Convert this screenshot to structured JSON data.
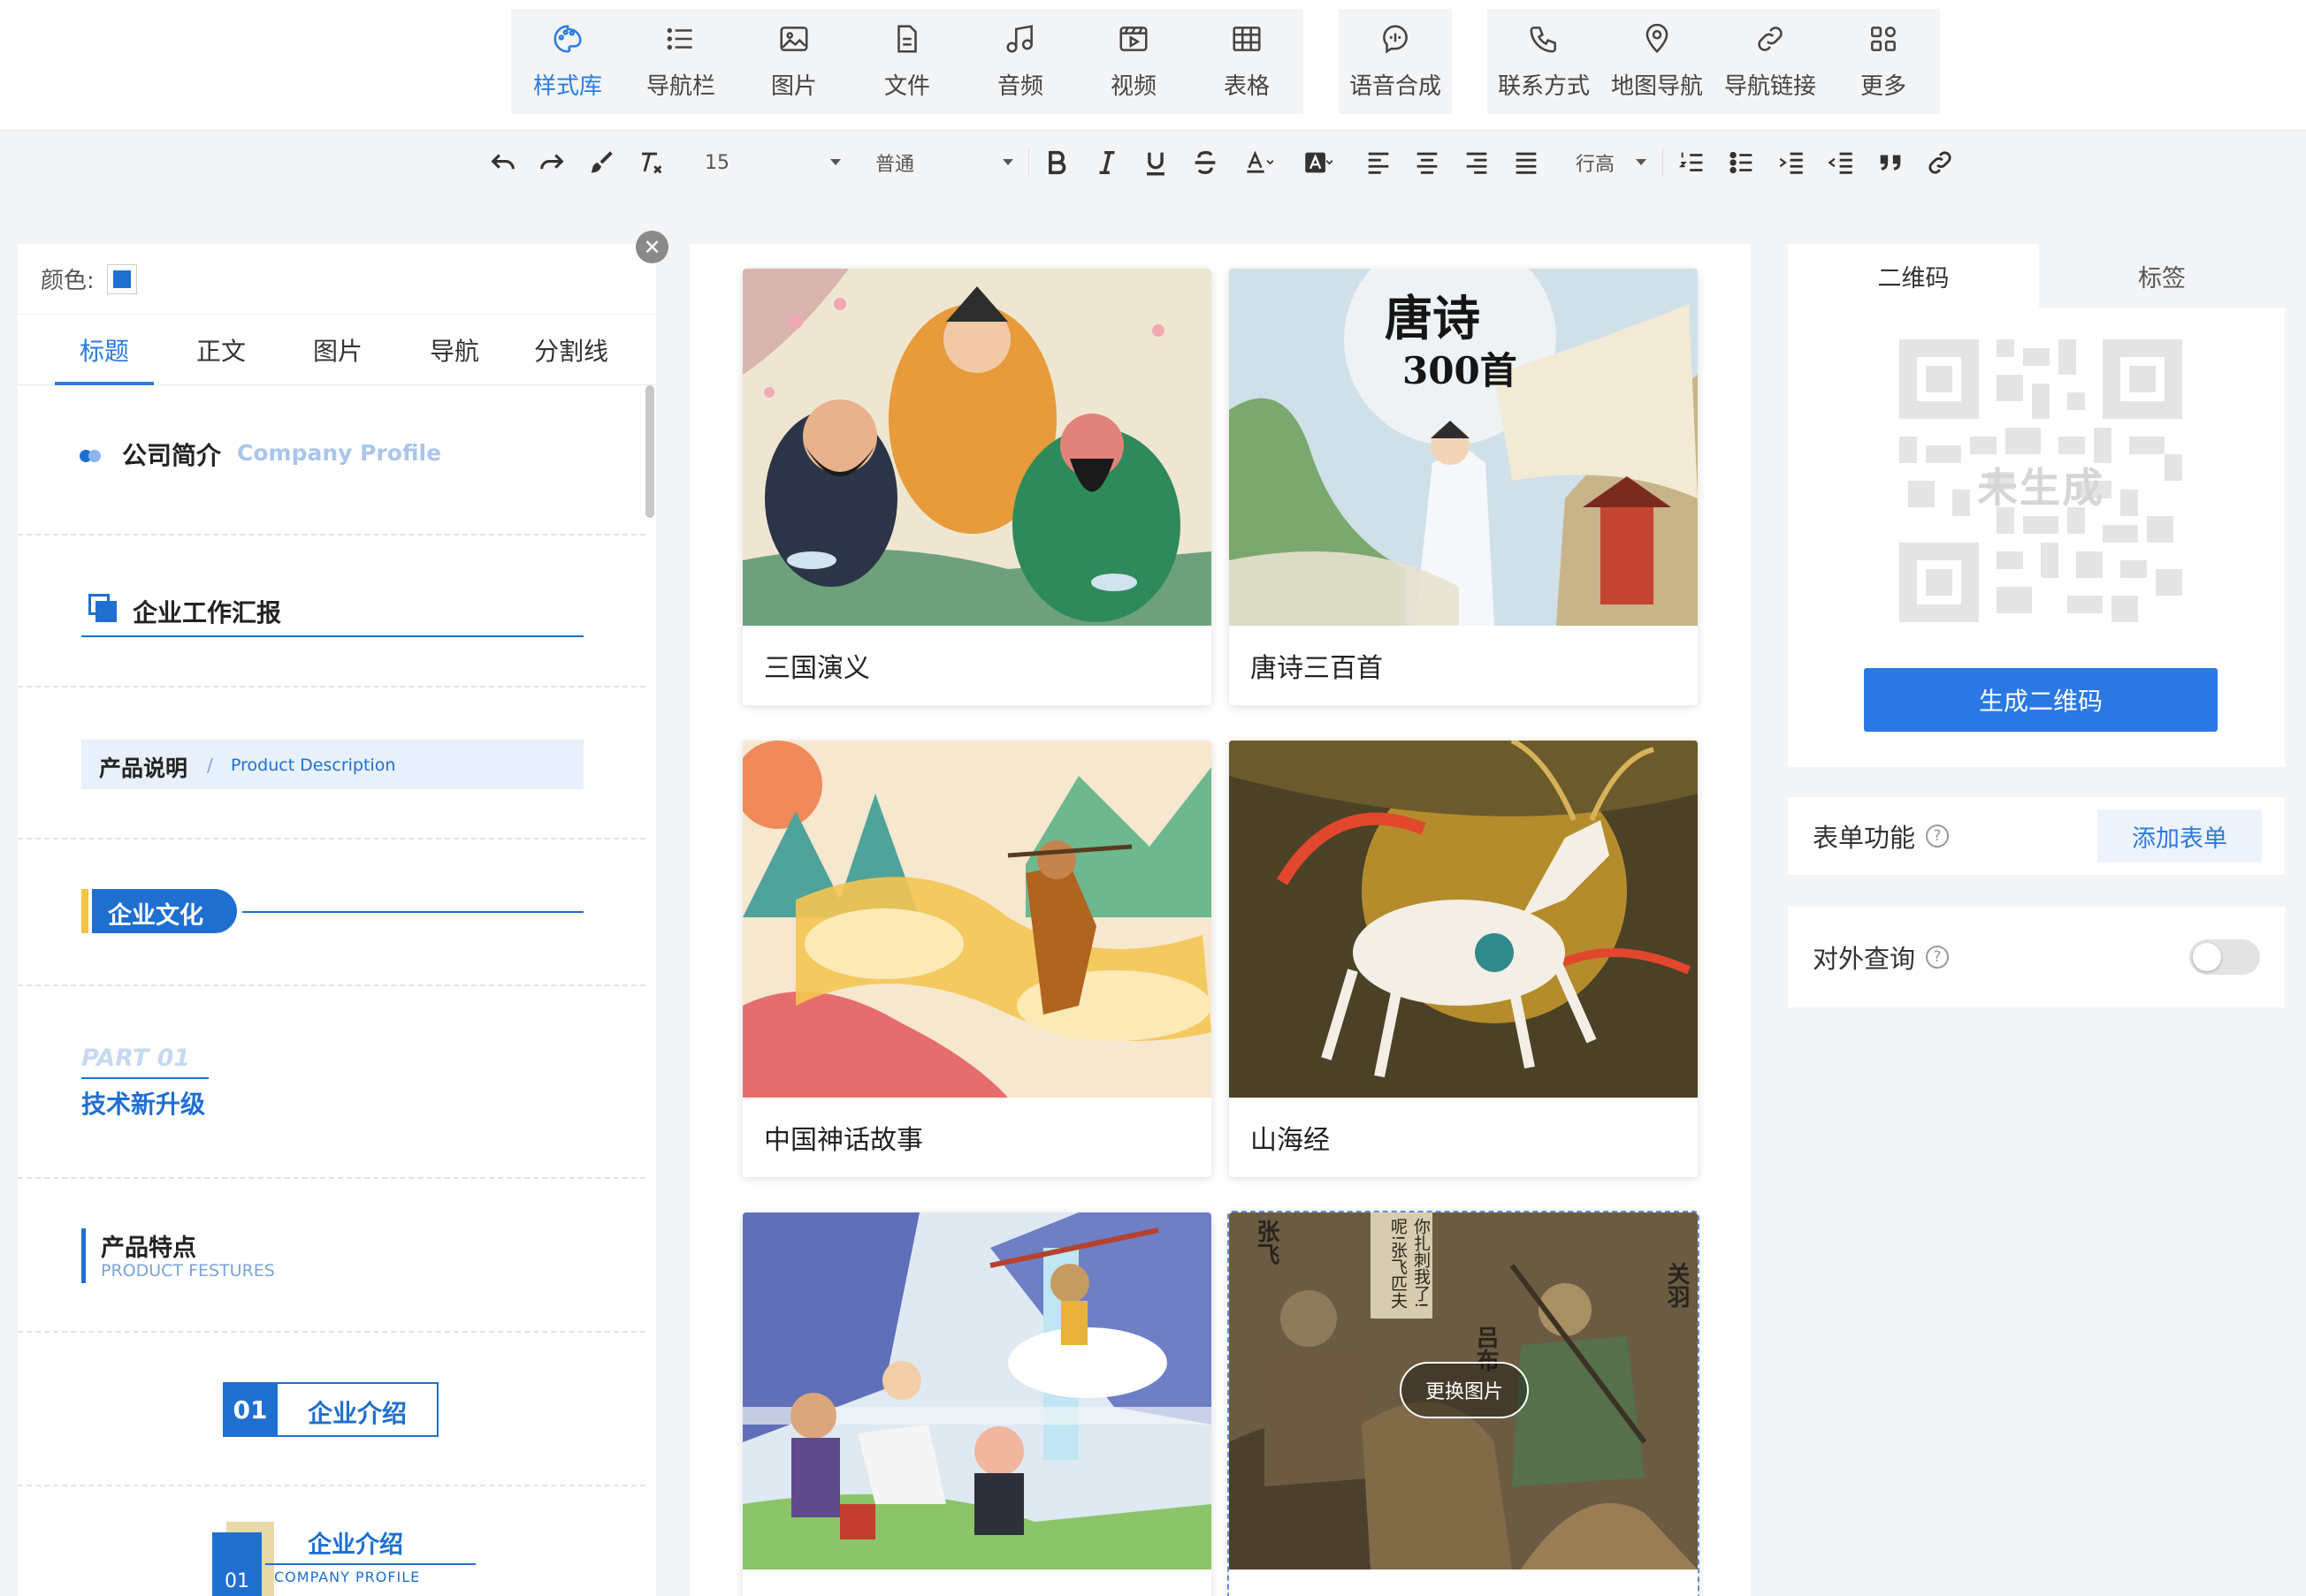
{
  "top_toolbar": {
    "items": [
      {
        "label": "样式库",
        "icon": "palette-icon",
        "active": true
      },
      {
        "label": "导航栏",
        "icon": "list-icon"
      },
      {
        "label": "图片",
        "icon": "image-icon"
      },
      {
        "label": "文件",
        "icon": "file-icon"
      },
      {
        "label": "音频",
        "icon": "music-note-icon"
      },
      {
        "label": "视频",
        "icon": "video-icon"
      },
      {
        "label": "表格",
        "icon": "table-icon"
      },
      {
        "label": "语音合成",
        "icon": "speech-synthesis-icon"
      },
      {
        "label": "联系方式",
        "icon": "phone-icon"
      },
      {
        "label": "地图导航",
        "icon": "map-pin-icon"
      },
      {
        "label": "导航链接",
        "icon": "link-icon"
      },
      {
        "label": "更多",
        "icon": "grid-more-icon"
      }
    ],
    "active_color": "#2b7be0"
  },
  "format_toolbar": {
    "font_size": "15",
    "paragraph_style": "普通",
    "line_height_label": "行高"
  },
  "left_panel": {
    "color_label": "颜色:",
    "color_value": "#1f6fd1",
    "tabs": [
      "标题",
      "正文",
      "图片",
      "导航",
      "分割线"
    ],
    "active_tab": 0,
    "styles": {
      "s1": {
        "title": "公司简介",
        "subtitle": "Company Profile"
      },
      "s2": {
        "title": "企业工作汇报"
      },
      "s3": {
        "title": "产品说明",
        "sep": "/",
        "subtitle": "Product Description"
      },
      "s4": {
        "title": "企业文化"
      },
      "s5": {
        "part": "PART 01",
        "title": "技术新升级"
      },
      "s6": {
        "title": "产品特点",
        "subtitle": "PRODUCT FESTURES"
      },
      "s7": {
        "num": "01",
        "title": "企业介绍"
      },
      "s8": {
        "num": "01",
        "title": "企业介绍",
        "subtitle": "COMPANY PROFILE"
      }
    }
  },
  "cards": [
    {
      "caption": "三国演义"
    },
    {
      "caption": "唐诗三百首",
      "art_title": "唐诗",
      "art_sub": "300首"
    },
    {
      "caption": "中国神话故事"
    },
    {
      "caption": "山海经"
    },
    {
      "caption": ""
    },
    {
      "caption": "",
      "selected": true,
      "art_labels": [
        "张飞",
        "吕布",
        "关羽"
      ],
      "art_text": "你扎刺我了!",
      "art_text2": "呢!张飞匹夫",
      "swap_label": "更换图片"
    }
  ],
  "right_panel": {
    "tabs": [
      "二维码",
      "标签"
    ],
    "qr_placeholder": "未生成",
    "generate_button": "生成二维码",
    "form_label": "表单功能",
    "add_form_button": "添加表单",
    "public_query_label": "对外查询",
    "public_query_enabled": false,
    "help_glyph": "?"
  }
}
